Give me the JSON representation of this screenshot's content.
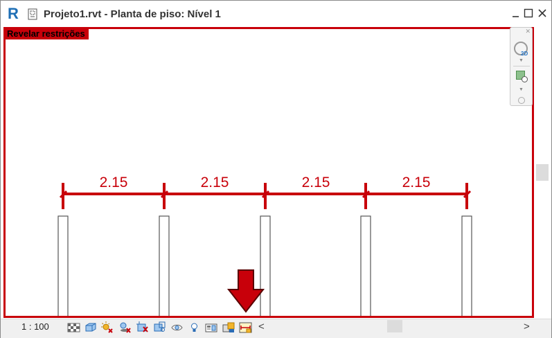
{
  "window": {
    "app_logo": "R",
    "doc_icon": "floor-plan-view-icon",
    "title": "Projeto1.rvt - Planta de piso: Nível 1",
    "controls": [
      "minimize-icon",
      "maximize-icon",
      "close-icon"
    ]
  },
  "canvas": {
    "mode_badge": "Revelar restrições",
    "highlight_color": "#c8000a",
    "dimensions": [
      "2.15",
      "2.15",
      "2.15",
      "2.15"
    ],
    "column_count": 5
  },
  "navigation_bar": {
    "items": [
      "steering-wheel-2d-icon",
      "zoom-region-icon"
    ]
  },
  "status_bar": {
    "scale": "1 : 100",
    "tools": [
      "detail-level-icon",
      "visual-style-icon",
      "sun-path-icon",
      "shadows-icon",
      "crop-view-icon",
      "show-crop-region-icon",
      "temporary-hide-icon",
      "reveal-hidden-elements-icon",
      "temporary-view-properties-icon",
      "worksharing-display-icon",
      "reveal-constraints-icon"
    ],
    "scroll_left": "<",
    "scroll_right": ">"
  },
  "annotation": {
    "arrow_color": "#c8000a",
    "points_to": "reveal-constraints-icon"
  }
}
